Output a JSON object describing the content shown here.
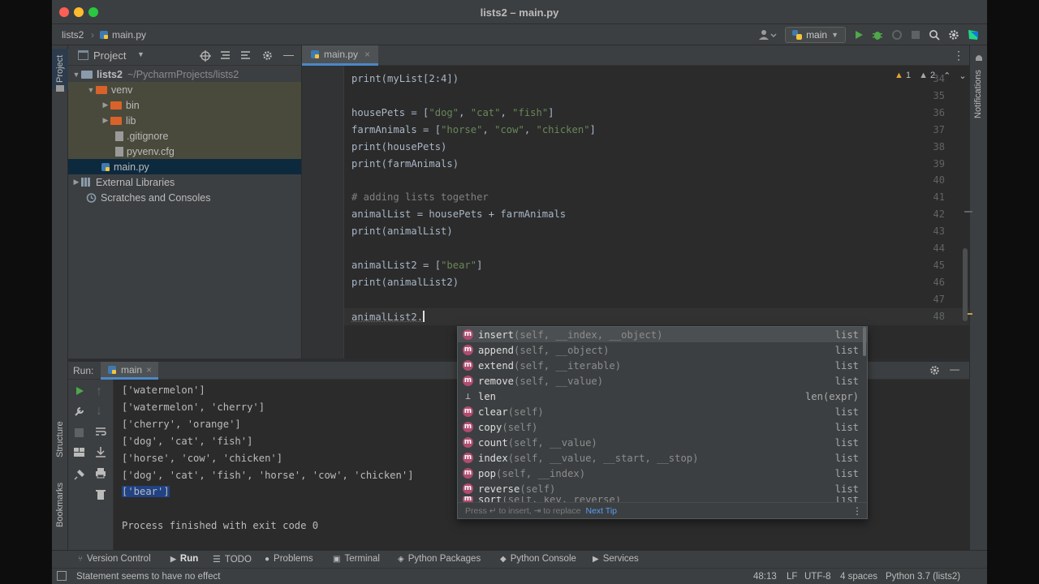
{
  "window": {
    "title": "lists2 – main.py"
  },
  "navbar": {
    "project": "lists2",
    "file": "main.py",
    "branch": "main"
  },
  "project_panel": {
    "title": "Project",
    "tree": [
      {
        "label": "lists2",
        "suffix": "~/PycharmProjects/lists2",
        "kind": "folder",
        "expanded": true
      },
      {
        "label": "venv",
        "kind": "folder",
        "expanded": true
      },
      {
        "label": "bin",
        "kind": "folder",
        "expanded": false
      },
      {
        "label": "lib",
        "kind": "folder",
        "expanded": false
      },
      {
        "label": ".gitignore",
        "kind": "file"
      },
      {
        "label": "pyvenv.cfg",
        "kind": "file"
      },
      {
        "label": "main.py",
        "kind": "python",
        "selected": true
      },
      {
        "label": "External Libraries",
        "kind": "library"
      },
      {
        "label": "Scratches and Consoles",
        "kind": "scratch"
      }
    ]
  },
  "side_tabs": {
    "project": "Project",
    "structure": "Structure",
    "bookmarks": "Bookmarks",
    "notifications": "Notifications"
  },
  "editor": {
    "tab": "main.py",
    "inspections": {
      "warnings": "1",
      "weak_warnings": "2"
    },
    "lines": [
      {
        "n": "34",
        "code": "print(myList[2:4])"
      },
      {
        "n": "35",
        "code": ""
      },
      {
        "n": "36",
        "code": "housePets = [\"dog\", \"cat\", \"fish\"]"
      },
      {
        "n": "37",
        "code": "farmAnimals = [\"horse\", \"cow\", \"chicken\"]"
      },
      {
        "n": "38",
        "code": "print(housePets)"
      },
      {
        "n": "39",
        "code": "print(farmAnimals)"
      },
      {
        "n": "40",
        "code": ""
      },
      {
        "n": "41",
        "code": "# adding lists together"
      },
      {
        "n": "42",
        "code": "animalList = housePets + farmAnimals"
      },
      {
        "n": "43",
        "code": "print(animalList)"
      },
      {
        "n": "44",
        "code": ""
      },
      {
        "n": "45",
        "code": "animalList2 = [\"bear\"]"
      },
      {
        "n": "46",
        "code": "print(animalList2)"
      },
      {
        "n": "47",
        "code": ""
      },
      {
        "n": "48",
        "code": "animalList2."
      }
    ]
  },
  "completion": {
    "items": [
      {
        "icon": "m",
        "name": "insert",
        "params": "(self, __index, __object)",
        "type": "list"
      },
      {
        "icon": "m",
        "name": "append",
        "params": "(self, __object)",
        "type": "list"
      },
      {
        "icon": "m",
        "name": "extend",
        "params": "(self, __iterable)",
        "type": "list"
      },
      {
        "icon": "m",
        "name": "remove",
        "params": "(self, __value)",
        "type": "list"
      },
      {
        "icon": "len",
        "name": "len",
        "params": "",
        "type": "len(expr)"
      },
      {
        "icon": "m",
        "name": "clear",
        "params": "(self)",
        "type": "list"
      },
      {
        "icon": "m",
        "name": "copy",
        "params": "(self)",
        "type": "list"
      },
      {
        "icon": "m",
        "name": "count",
        "params": "(self, __value)",
        "type": "list"
      },
      {
        "icon": "m",
        "name": "index",
        "params": "(self, __value, __start, __stop)",
        "type": "list"
      },
      {
        "icon": "m",
        "name": "pop",
        "params": "(self, __index)",
        "type": "list"
      },
      {
        "icon": "m",
        "name": "reverse",
        "params": "(self)",
        "type": "list"
      },
      {
        "icon": "m",
        "name": "sort",
        "params": "(self, key, reverse)",
        "type": "list"
      }
    ],
    "footer": "Press ↵ to insert, ⇥ to replace",
    "next_tip": "Next Tip"
  },
  "run_panel": {
    "label": "Run:",
    "config": "main",
    "output": [
      "['watermelon']",
      "['watermelon', 'cherry']",
      "['cherry', 'orange']",
      "['dog', 'cat', 'fish']",
      "['horse', 'cow', 'chicken']",
      "['dog', 'cat', 'fish', 'horse', 'cow', 'chicken']",
      "['bear']",
      "",
      "Process finished with exit code 0"
    ]
  },
  "bottom_tabs": [
    {
      "label": "Version Control",
      "icon": "branch-icon"
    },
    {
      "label": "Run",
      "icon": "run-icon"
    },
    {
      "label": "TODO",
      "icon": "list-icon"
    },
    {
      "label": "Problems",
      "icon": "warning-icon"
    },
    {
      "label": "Terminal",
      "icon": "terminal-icon"
    },
    {
      "label": "Python Packages",
      "icon": "packages-icon"
    },
    {
      "label": "Python Console",
      "icon": "console-icon"
    },
    {
      "label": "Services",
      "icon": "services-icon"
    }
  ],
  "status": {
    "message": "Statement seems to have no effect",
    "position": "48:13",
    "line_sep": "LF",
    "encoding": "UTF-8",
    "indent": "4 spaces",
    "interpreter": "Python 3.7 (lists2)"
  },
  "colors": {
    "accent": "#4a88c7",
    "method_badge": "#b04c6f",
    "string": "#6a8759",
    "comment": "#808080"
  }
}
